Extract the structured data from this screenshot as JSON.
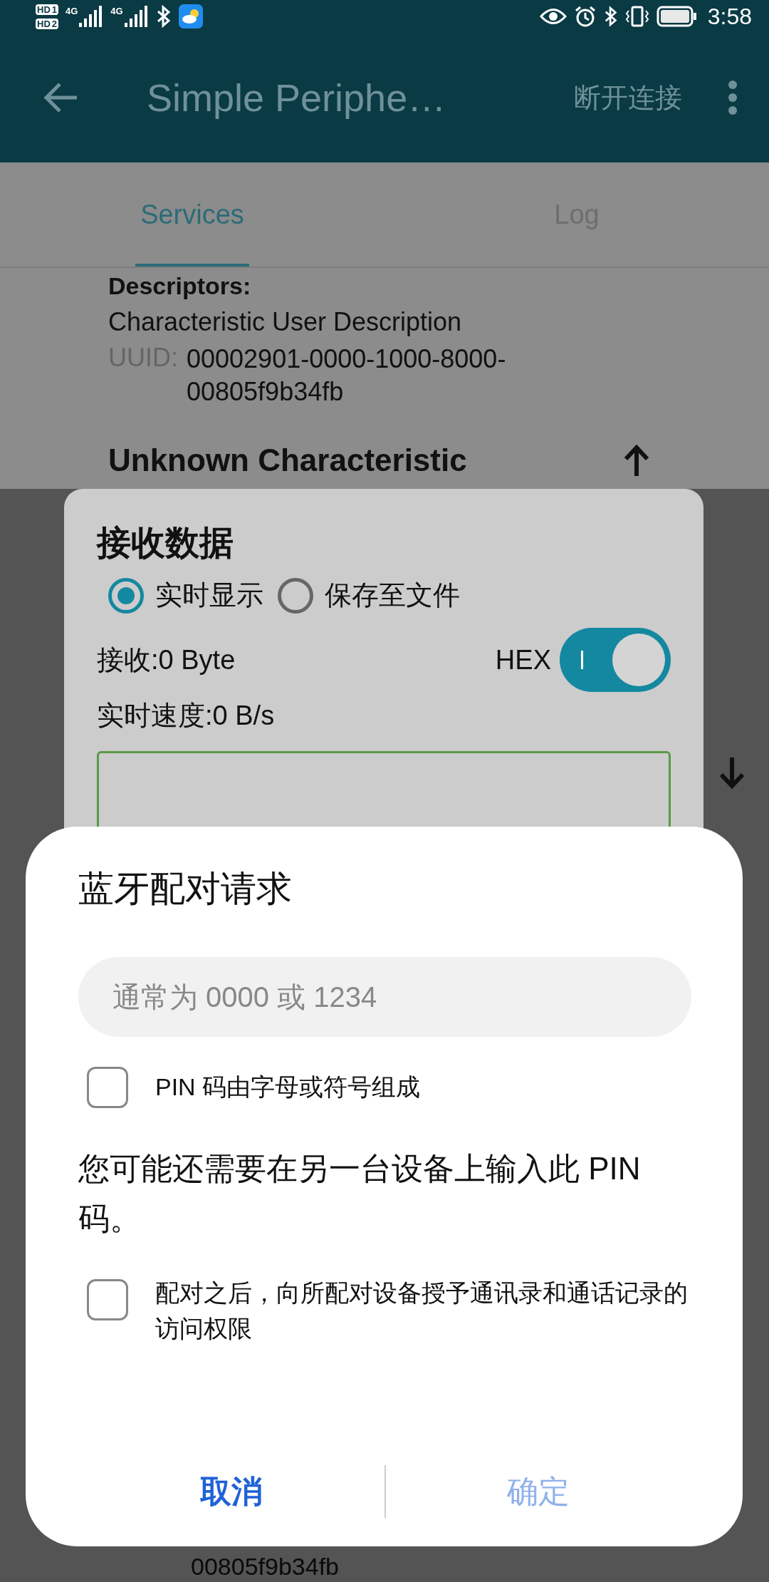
{
  "status_bar": {
    "sims": [
      {
        "badge": "HD",
        "slot": "1",
        "network": "4G"
      },
      {
        "badge": "HD",
        "slot": "2",
        "network": "4G"
      }
    ],
    "time": "3:58"
  },
  "app_bar": {
    "title": "Simple Periphe…",
    "action": "断开连接"
  },
  "tabs": [
    {
      "label": "Services",
      "selected": true
    },
    {
      "label": "Log",
      "selected": false
    }
  ],
  "content": {
    "descriptors_label": "Descriptors:",
    "descriptor_name": "Characteristic User Description",
    "uuid_label": "UUID:",
    "uuid": "00002901-0000-1000-8000-00805f9b34fb",
    "characteristic_title": "Unknown Characteristic",
    "bottom_uuid_fragment": "00805f9b34fb"
  },
  "receive_dialog": {
    "title": "接收数据",
    "modes": [
      {
        "label": "实时显示",
        "selected": true
      },
      {
        "label": "保存至文件",
        "selected": false
      }
    ],
    "received": "接收:0 Byte",
    "hex": {
      "label": "HEX",
      "on": true
    },
    "speed": "实时速度:0 B/s"
  },
  "pairing_dialog": {
    "title": "蓝牙配对请求",
    "pin_field": {
      "placeholder": "通常为 0000 或 1234"
    },
    "pin_option": {
      "label": "PIN 码由字母或符号组成",
      "checked": false
    },
    "note": "您可能还需要在另一台设备上输入此 PIN 码。",
    "contacts_option": {
      "label": "配对之后，向所配对设备授予通讯录和通话记录的访问权限",
      "checked": false
    },
    "buttons": [
      {
        "label": "取消",
        "disabled": false
      },
      {
        "label": "确定",
        "disabled": true
      }
    ]
  }
}
